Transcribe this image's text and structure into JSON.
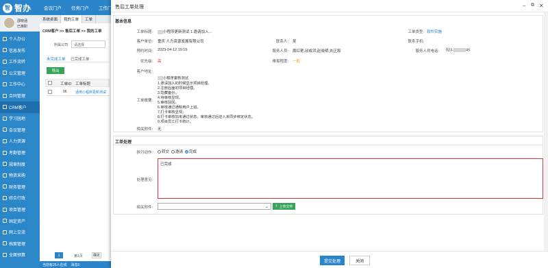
{
  "app": {
    "logo_glyph": "智",
    "logo_text": "智办",
    "top_nav": [
      "会议门户",
      "任务门户",
      "工作门"
    ]
  },
  "user": {
    "name": "邵晓涵",
    "status": "已离职"
  },
  "sidebar": {
    "items": [
      {
        "label": "个人办公"
      },
      {
        "label": "信息发布"
      },
      {
        "label": "工作流转"
      },
      {
        "label": "公文管理"
      },
      {
        "label": "工作中心"
      },
      {
        "label": "合同管理"
      },
      {
        "label": "CRM客户"
      },
      {
        "label": "学习园地"
      },
      {
        "label": "会议管理"
      },
      {
        "label": "人力资源"
      },
      {
        "label": "考勤管理"
      },
      {
        "label": "规章制度"
      },
      {
        "label": "物资采购"
      },
      {
        "label": "财务管理"
      },
      {
        "label": "综合行政"
      },
      {
        "label": "项目管理"
      },
      {
        "label": "固定资产"
      },
      {
        "label": "网上交流"
      },
      {
        "label": "档案管理"
      },
      {
        "label": "全面预算"
      }
    ],
    "active_index": 6
  },
  "status_bar": {
    "online": "当前有25人在线",
    "messages": "消息0"
  },
  "middle": {
    "tabs": [
      "系统桌面",
      "我的工单",
      "工单"
    ],
    "breadcrumb": "CRM客户 >> 售后工单 >> 我的工单",
    "company_label": "所属公司",
    "company_value": "请选择",
    "subtabs": [
      "未完成工单",
      "已完成工单"
    ],
    "export_label": "导出",
    "table_headers": [
      "工单ID",
      "工单标题"
    ],
    "rows": [
      {
        "id": "96",
        "title": "适用小程序更新测试"
      }
    ],
    "pager": "1",
    "pager_page": "第1页",
    "pager_go": "确定"
  },
  "modal": {
    "title": "售后工单处理",
    "section_basic": "基本信息",
    "fields": {
      "title_label": "工单标题:",
      "title_value": "小程序更新测试 1.邀请加入...",
      "type_label": "工单类型:",
      "type_value": "软件实施",
      "customer_label": "客户单位:",
      "customer_value": "重庆 人力资源发展有限公司",
      "contact_label": "联系人:",
      "contact_value": "吴",
      "phone_label": "联系手机:",
      "phone_value": "",
      "time_label": "预约时间:",
      "time_value": "2023-04-12 19:15",
      "staff_label": "服务人员:",
      "staff_value": "周红艳,邱成洪,赵晓明,刘正和",
      "staff_phone_label": "服务人员电话:",
      "staff_phone_value": "023-",
      "staff_phone_suffix": "45",
      "priority_label": "优先级:",
      "priority_value": "高",
      "difficulty_label": "难易程度:",
      "difficulty_value": "一般",
      "address_label": "客户地址:",
      "address_value": "",
      "summary_label": "工单概要:",
      "summary_lines": [
        "小程序更新测试",
        "1.邀请加入的时候显示项目经理。",
        "2.注册后面初项目经理。",
        "3.隐藏备份。",
        "4.待审核显现。",
        "5.审核驳回。",
        "6.审核通过通知用户上班。",
        "7.打卡审核显现。",
        "8.打卡审核加未通过状态，审核通过后进入未同步绑定状态。",
        "9.项目员工打卡统计。"
      ],
      "attach_label": "相关附件:",
      "attach_value": "无"
    },
    "section_process": "工单处理",
    "action_label": "执行动作:",
    "actions": [
      "转交",
      "邀请",
      "完成"
    ],
    "selected_action": "完成",
    "opinion_label": "处理意见:",
    "opinion_value": "已完成",
    "process_attach_label": "相关附件:",
    "upload_label": "上传文件",
    "submit_label": "提交处理",
    "close_label": "关闭",
    "colors": {
      "accent": "#2a84c9",
      "green": "#3aa35b",
      "red": "#e03030"
    }
  }
}
